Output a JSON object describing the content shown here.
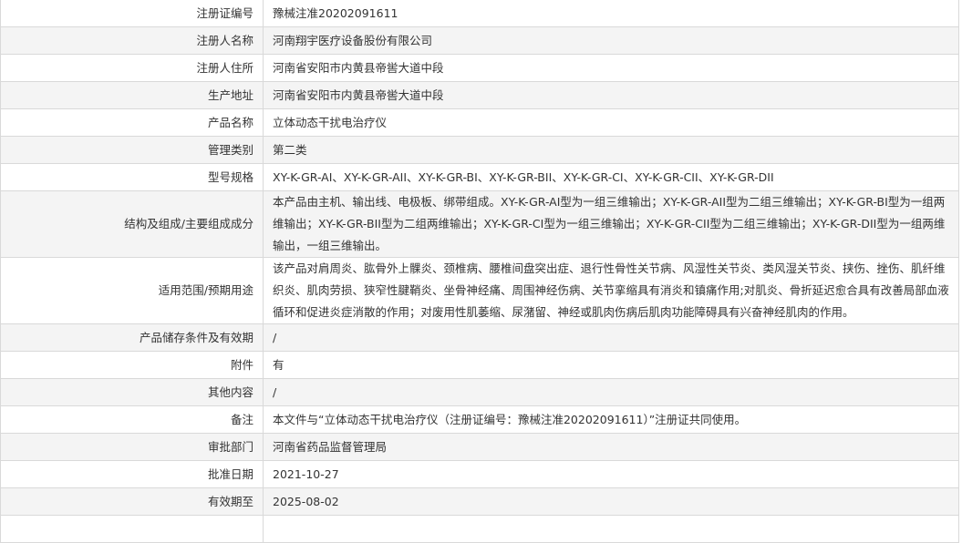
{
  "rows": [
    {
      "label": "注册证编号",
      "value": "豫械注准20202091611"
    },
    {
      "label": "注册人名称",
      "value": "河南翔宇医疗设备股份有限公司"
    },
    {
      "label": "注册人住所",
      "value": "河南省安阳市内黄县帝喾大道中段"
    },
    {
      "label": "生产地址",
      "value": "河南省安阳市内黄县帝喾大道中段"
    },
    {
      "label": "产品名称",
      "value": "立体动态干扰电治疗仪"
    },
    {
      "label": "管理类别",
      "value": "第二类"
    },
    {
      "label": "型号规格",
      "value": "XY-K-GR-AI、XY-K-GR-AII、XY-K-GR-BI、XY-K-GR-BII、XY-K-GR-CI、XY-K-GR-CII、XY-K-GR-DII"
    },
    {
      "label": "结构及组成/主要组成成分",
      "value": "本产品由主机、输出线、电极板、绑带组成。XY-K-GR-AI型为一组三维输出；XY-K-GR-AII型为二组三维输出；XY-K-GR-BI型为一组两维输出；XY-K-GR-BII型为二组两维输出；XY-K-GR-CI型为一组三维输出；XY-K-GR-CII型为二组三维输出；XY-K-GR-DII型为一组两维输出，一组三维输出。"
    },
    {
      "label": "适用范围/预期用途",
      "value": "该产品对肩周炎、肱骨外上髁炎、颈椎病、腰椎间盘突出症、退行性骨性关节病、风湿性关节炎、类风湿关节炎、挟伤、挫伤、肌纤维织炎、肌肉劳损、狭窄性腱鞘炎、坐骨神经痛、周围神经伤病、关节挛缩具有消炎和镇痛作用;对肌炎、骨折延迟愈合具有改善局部血液循环和促进炎症消散的作用；对废用性肌萎缩、尿潴留、神经或肌肉伤病后肌肉功能障碍具有兴奋神经肌肉的作用。"
    },
    {
      "label": "产品储存条件及有效期",
      "value": "/"
    },
    {
      "label": "附件",
      "value": "有"
    },
    {
      "label": "其他内容",
      "value": "/"
    },
    {
      "label": "备注",
      "value": "本文件与“立体动态干扰电治疗仪（注册证编号：豫械注准20202091611）”注册证共同使用。"
    },
    {
      "label": "审批部门",
      "value": "河南省药品监督管理局"
    },
    {
      "label": "批准日期",
      "value": "2021-10-27"
    },
    {
      "label": "有效期至",
      "value": "2025-08-02"
    },
    {
      "label": "",
      "value": ""
    }
  ]
}
